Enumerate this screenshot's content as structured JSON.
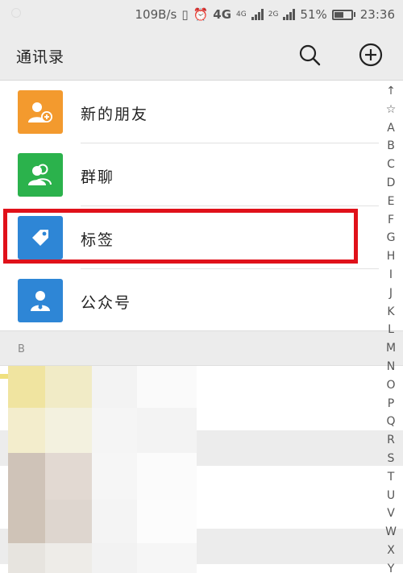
{
  "status_bar": {
    "net_speed": "109B/s",
    "network_4g": "4G",
    "network_4g_small": "4G",
    "network_2g": "2G",
    "battery": "51%",
    "time": "23:36",
    "battery_level": 0.51
  },
  "header": {
    "title": "通讯录",
    "search_icon": "search-icon",
    "add_icon": "plus-circle-icon"
  },
  "list": {
    "items": [
      {
        "label": "新的朋友",
        "icon": "add-friend-icon",
        "color": "#f39a2e"
      },
      {
        "label": "群聊",
        "icon": "group-chat-icon",
        "color": "#2bb24c"
      },
      {
        "label": "标签",
        "icon": "tag-icon",
        "color": "#2e86d6"
      },
      {
        "label": "公众号",
        "icon": "official-account-icon",
        "color": "#2e86d6"
      }
    ]
  },
  "section": {
    "letter": "B"
  },
  "index": [
    "↑",
    "☆",
    "A",
    "B",
    "C",
    "D",
    "E",
    "F",
    "G",
    "H",
    "I",
    "J",
    "K",
    "L",
    "M",
    "N",
    "O",
    "P",
    "Q",
    "R",
    "S",
    "T",
    "U",
    "V",
    "W",
    "X",
    "Y"
  ],
  "colors": {
    "highlight": "#e0111a",
    "background": "#ececec"
  }
}
